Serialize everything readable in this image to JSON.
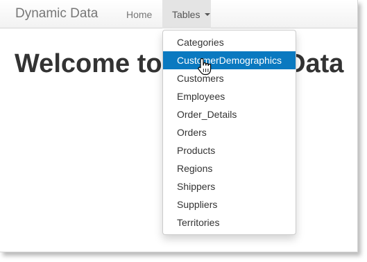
{
  "navbar": {
    "brand": "Dynamic Data",
    "home_label": "Home",
    "tables_label": "Tables"
  },
  "main": {
    "heading": "Welcome to Dynamic Data"
  },
  "dropdown": {
    "items": [
      {
        "label": "Categories"
      },
      {
        "label": "CustomerDemographics",
        "highlighted": true
      },
      {
        "label": "Customers"
      },
      {
        "label": "Employees"
      },
      {
        "label": "Order_Details"
      },
      {
        "label": "Orders"
      },
      {
        "label": "Products"
      },
      {
        "label": "Regions"
      },
      {
        "label": "Shippers"
      },
      {
        "label": "Suppliers"
      },
      {
        "label": "Territories"
      }
    ]
  },
  "icons": {
    "caret": "caret-down-icon",
    "cursor": "hand-pointer-icon"
  },
  "colors": {
    "highlight": "#0a79c0",
    "nav_active": "#e4e4e4",
    "heading": "#333333"
  }
}
